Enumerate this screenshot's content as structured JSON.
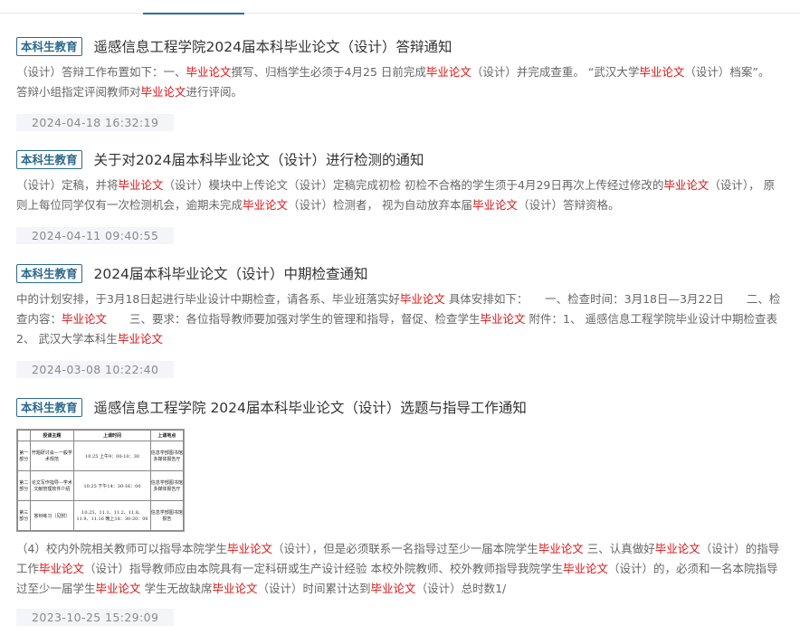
{
  "results": [
    {
      "badge": "本科生教育",
      "title": "遥感信息工程学院2024届本科毕业论文（设计）答辩通知",
      "snippet": [
        {
          "t": "（设计）答辩工作布置如下：一、"
        },
        {
          "t": "毕业论文",
          "hl": true
        },
        {
          "t": "撰写、归档学生必须于4月25 日前完成"
        },
        {
          "t": "毕业论文",
          "hl": true
        },
        {
          "t": "（设计）并完成查重。 “武汉大学"
        },
        {
          "t": "毕业论文",
          "hl": true
        },
        {
          "t": "（设计）档案”。 答辩小组指定评阅教师对"
        },
        {
          "t": "毕业论文",
          "hl": true
        },
        {
          "t": "进行评阅。"
        }
      ],
      "date": "2024-04-18 16:32:19"
    },
    {
      "badge": "本科生教育",
      "title": "关于对2024届本科毕业论文（设计）进行检测的通知",
      "snippet": [
        {
          "t": "（设计）定稿，并将"
        },
        {
          "t": "毕业论文",
          "hl": true
        },
        {
          "t": "（设计）模块中上传论文（设计）定稿完成初检 初检不合格的学生须于4月29日再次上传经过修改的"
        },
        {
          "t": "毕业论文",
          "hl": true
        },
        {
          "t": "（设计）， 原则上每位同学仅有一次检测机会，逾期未完成"
        },
        {
          "t": "毕业论文",
          "hl": true
        },
        {
          "t": "（设计）检测者， 视为自动放弃本届"
        },
        {
          "t": "毕业论文",
          "hl": true
        },
        {
          "t": "（设计）答辩资格。"
        }
      ],
      "date": "2024-04-11 09:40:55"
    },
    {
      "badge": "本科生教育",
      "title": "2024届本科毕业论文（设计）中期检查通知",
      "snippet": [
        {
          "t": "中的计划安排，于3月18日起进行毕业设计中期检查，请各系、毕业班落实好"
        },
        {
          "t": "毕业论文",
          "hl": true
        },
        {
          "t": " 具体安排如下：　　一、检查时间：3月18日—3月22日　　二、检查内容："
        },
        {
          "t": "毕业论文",
          "hl": true
        },
        {
          "t": "　　三、要求：各位指导教师要加强对学生的管理和指导，督促、检查学生"
        },
        {
          "t": "毕业论文",
          "hl": true
        },
        {
          "t": " 附件：1、 遥感信息工程学院毕业设计中期检查表2、 武汉大学本科生"
        },
        {
          "t": "毕业论文",
          "hl": true
        }
      ],
      "date": "2024-03-08 10:22:40"
    },
    {
      "badge": "本科生教育",
      "title": "遥感信息工程学院 2024届本科毕业论文（设计）选题与指导工作通知",
      "thumb": {
        "headers": [
          "",
          "授课主题",
          "上课时间",
          "上课地点"
        ],
        "rows": [
          [
            "第一部分",
            "开题研讨会—一般学术规范",
            "10.25 上午9：00-10：30",
            "信息学部图书馆多媒体报告厅"
          ],
          [
            "第二部分",
            "论文写作指导—学术文献管理软件介绍",
            "10.25 下午14：30-16：00",
            "信息学部图书馆多媒体报告厅"
          ],
          [
            "第三部分",
            "答辩练习（见附）",
            "10.25、11.1、11.2、11.8、11.9、11.16 晚上18：30-20：00",
            "信息学部图书馆报告"
          ]
        ]
      },
      "snippet": [
        {
          "t": "（4）校内外院相关教师可以指导本院学生"
        },
        {
          "t": "毕业论文",
          "hl": true
        },
        {
          "t": "（设计），但是必须联系一名指导过至少一届本院学生"
        },
        {
          "t": "毕业论文",
          "hl": true
        },
        {
          "t": " 三、认真做好"
        },
        {
          "t": "毕业论文",
          "hl": true
        },
        {
          "t": "（设计）的指导工作"
        },
        {
          "t": "毕业论文",
          "hl": true
        },
        {
          "t": "（设计）指导教师应由本院具有一定科研或生产设计经验 本校外院教师、校外教师指导我院学生"
        },
        {
          "t": "毕业论文",
          "hl": true
        },
        {
          "t": "（设计）的，必须和一名本院指导过至少一届学生"
        },
        {
          "t": "毕业论文",
          "hl": true
        },
        {
          "t": " 学生无故缺席"
        },
        {
          "t": "毕业论文",
          "hl": true
        },
        {
          "t": "（设计）时间累计达到"
        },
        {
          "t": "毕业论文",
          "hl": true
        },
        {
          "t": "（设计）总时数1/"
        }
      ],
      "date": "2023-10-25 15:29:09"
    }
  ]
}
